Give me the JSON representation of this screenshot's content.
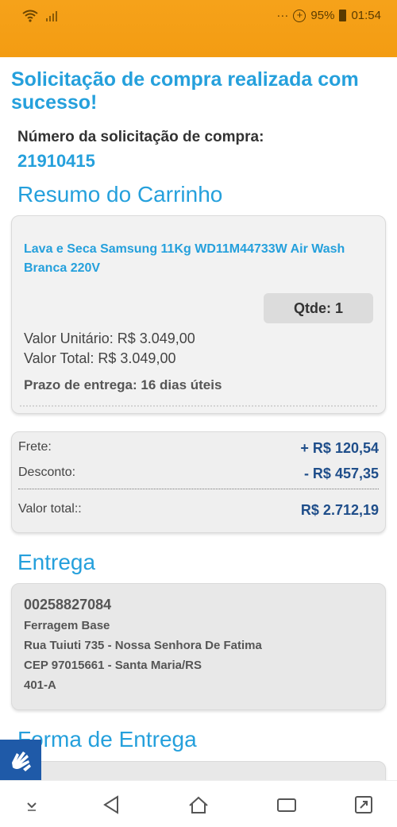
{
  "status_bar": {
    "battery": "95%",
    "time": "01:54",
    "dots": "···",
    "plus": "+"
  },
  "page": {
    "title": "Solicitação de compra realizada com sucesso!",
    "order_label": "Número da solicitação de compra:",
    "order_number": "21910415"
  },
  "cart": {
    "section_title": "Resumo do Carrinho",
    "product_name": "Lava e Seca Samsung 11Kg WD11M44733W Air Wash Branca 220V",
    "quantity": "Qtde: 1",
    "unit_price": "Valor Unitário:  R$ 3.049,00",
    "total_price": "Valor Total:  R$ 3.049,00",
    "delivery_time": "Prazo de entrega: 16 dias úteis"
  },
  "totals": {
    "shipping_label": "Frete:",
    "shipping_value": "+ R$ 120,54",
    "discount_label": "Desconto:",
    "discount_value": "- R$ 457,35",
    "total_label": "Valor total::",
    "total_value": "R$ 2.712,19"
  },
  "delivery": {
    "section_title": "Entrega",
    "code": "00258827084",
    "name": "Ferragem Base",
    "street": "Rua Tuiuti  735 - Nossa Senhora De Fatima",
    "cep": "CEP 97015661 - Santa Maria/RS",
    "complement": "401-A"
  },
  "delivery_method": {
    "section_title": "Forma de Entrega"
  },
  "colors": {
    "accent": "#25a0dc",
    "status_bar": "#f39c12",
    "value_text": "#1f4e8a",
    "accessibility": "#1f5aa8"
  },
  "icons": {
    "wifi": "wifi-icon",
    "signal": "signal-icon",
    "accessibility": "sign-language-icon",
    "nav": [
      "keyboard-down-icon",
      "back-icon",
      "home-icon",
      "recents-icon",
      "rotate-icon"
    ]
  }
}
